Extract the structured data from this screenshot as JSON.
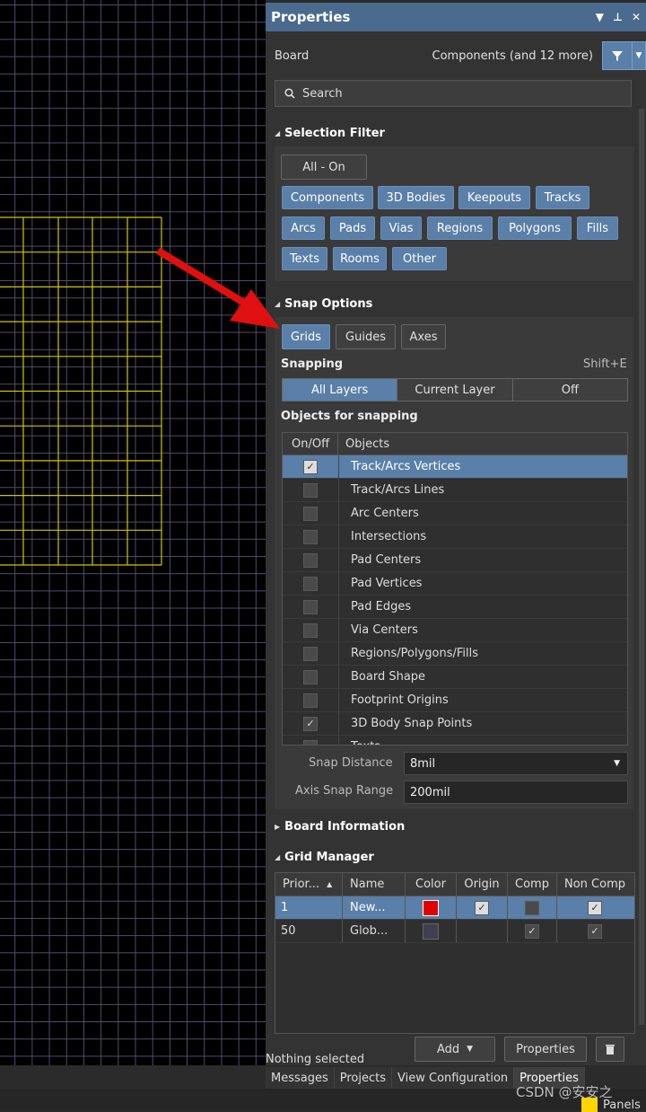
{
  "panel": {
    "title": "Properties",
    "title_controls": [
      "▼",
      "⊥",
      "✕"
    ],
    "board_label": "Board",
    "components_label": "Components (and 12 more)",
    "search_placeholder": "Search"
  },
  "selection_filter": {
    "header": "Selection Filter",
    "all_on": "All - On",
    "buttons": [
      "Components",
      "3D Bodies",
      "Keepouts",
      "Tracks",
      "Arcs",
      "Pads",
      "Vias",
      "Regions",
      "Polygons",
      "Fills",
      "Texts",
      "Rooms",
      "Other"
    ]
  },
  "snap_options": {
    "header": "Snap Options",
    "grids": "Grids",
    "guides": "Guides",
    "axes": "Axes",
    "snapping_label": "Snapping",
    "shortcut": "Shift+E",
    "modes": [
      "All Layers",
      "Current Layer",
      "Off"
    ],
    "objects_label": "Objects for snapping",
    "col_onoff": "On/Off",
    "col_objects": "Objects",
    "objects": [
      {
        "name": "Track/Arcs Vertices",
        "checked": true
      },
      {
        "name": "Track/Arcs Lines",
        "checked": false
      },
      {
        "name": "Arc Centers",
        "checked": false
      },
      {
        "name": "Intersections",
        "checked": false
      },
      {
        "name": "Pad Centers",
        "checked": false
      },
      {
        "name": "Pad Vertices",
        "checked": false
      },
      {
        "name": "Pad Edges",
        "checked": false
      },
      {
        "name": "Via Centers",
        "checked": false
      },
      {
        "name": "Regions/Polygons/Fills",
        "checked": false
      },
      {
        "name": "Board Shape",
        "checked": false
      },
      {
        "name": "Footprint Origins",
        "checked": false
      },
      {
        "name": "3D Body Snap Points",
        "checked": true
      },
      {
        "name": "Texts",
        "checked": false
      }
    ],
    "snap_distance_label": "Snap Distance",
    "snap_distance_value": "8mil",
    "axis_snap_label": "Axis Snap Range",
    "axis_snap_value": "200mil"
  },
  "board_information": {
    "header": "Board Information"
  },
  "grid_manager": {
    "header": "Grid Manager",
    "columns": [
      "Prior...",
      "Name",
      "Color",
      "Origin",
      "Comp",
      "Non Comp"
    ],
    "rows": [
      {
        "priority": "1",
        "name": "New...",
        "color": "#e00000"
      },
      {
        "priority": "50",
        "name": "Glob...",
        "color": "#404050"
      }
    ],
    "add_label": "Add",
    "properties_label": "Properties"
  },
  "status_text": "Nothing selected",
  "tabs": [
    "Messages",
    "Projects",
    "View Configuration",
    "Properties"
  ],
  "watermark": "CSDN @安安之",
  "panels_label": "Panels"
}
